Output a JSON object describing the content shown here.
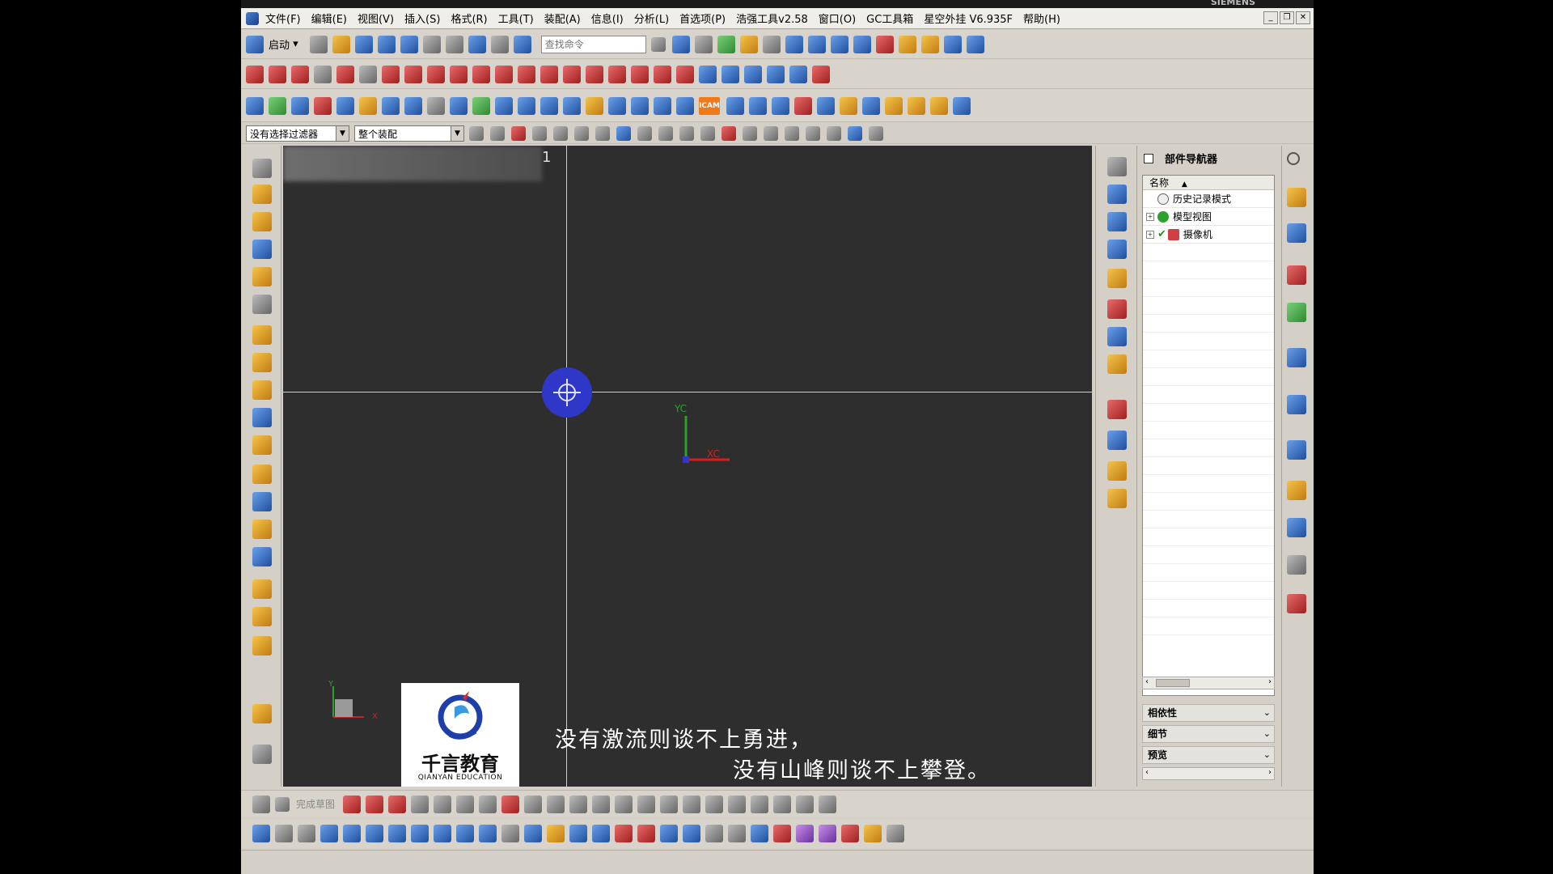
{
  "titlebar": {
    "brand": "SIEMENS"
  },
  "menu": [
    "文件(F)",
    "编辑(E)",
    "视图(V)",
    "插入(S)",
    "格式(R)",
    "工具(T)",
    "装配(A)",
    "信息(I)",
    "分析(L)",
    "首选项(P)",
    "浩强工具v2.58",
    "窗口(O)",
    "GC工具箱",
    "星空外挂 V6.935F",
    "帮助(H)"
  ],
  "toolbar": {
    "start_label": "启动",
    "search_placeholder": "查找命令",
    "icam_label": "ICAM"
  },
  "selection_bar": {
    "filter_value": "没有选择过滤器",
    "scope_value": "整个装配"
  },
  "viewport": {
    "title_number": "1",
    "wcs_y_label": "YC",
    "wcs_x_label": "XC",
    "mini_y_label": "Y",
    "mini_x_label": "X"
  },
  "logo": {
    "cn": "千言教育",
    "en": "QIANYAN EDUCATION"
  },
  "subtitles": {
    "line1": "没有激流则谈不上勇进，",
    "line2": "没有山峰则谈不上攀登。"
  },
  "navigator": {
    "title": "部件导航器",
    "column_header": "名称",
    "items": [
      {
        "label": "历史记录模式"
      },
      {
        "label": "模型视图"
      },
      {
        "label": "摄像机"
      }
    ],
    "sections": [
      "相依性",
      "细节",
      "预览"
    ]
  },
  "bottom_toolbar": {
    "finish_sketch": "完成草图"
  },
  "colors": {
    "viewport_bg": "#2e2e2e",
    "origin_marker": "#2f37c8",
    "ycol": "#2ea02e",
    "xcol": "#d02020"
  }
}
